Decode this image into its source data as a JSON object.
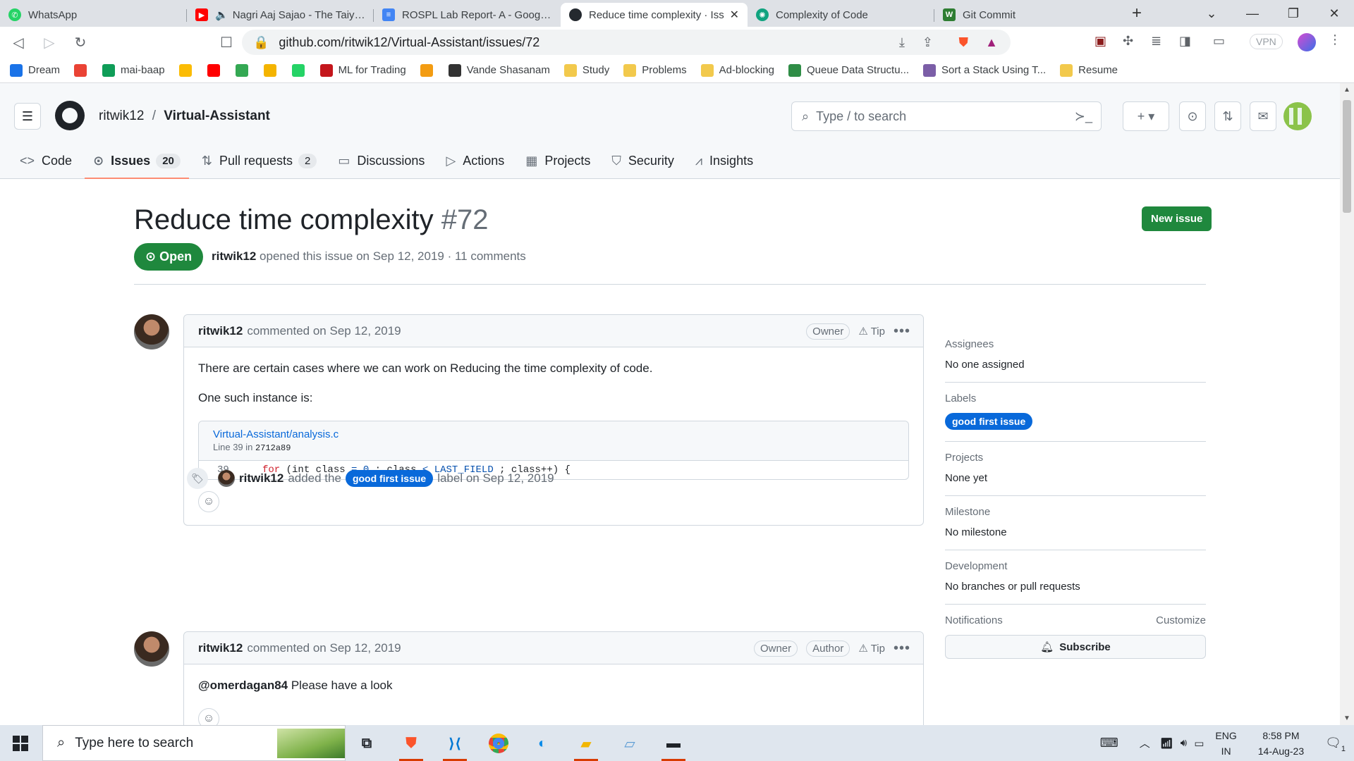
{
  "browser": {
    "tabs": [
      {
        "title": "WhatsApp",
        "color": "#25d366"
      },
      {
        "title": "Nagri Aaj Sajao - The Taiyyari",
        "color": "#ff0000"
      },
      {
        "title": "ROSPL Lab Report- A - Google D",
        "color": "#4285f4"
      },
      {
        "title": "Reduce time complexity · Iss",
        "color": "#24292f",
        "active": true
      },
      {
        "title": "Complexity of Code",
        "color": "#10a37f"
      },
      {
        "title": "Git Commit",
        "color": "#2e7d32"
      }
    ],
    "url": "github.com/ritwik12/Virtual-Assistant/issues/72",
    "vpn_label": "VPN",
    "bookmarks": [
      {
        "label": "Dream",
        "color": "#1a73e8"
      },
      {
        "label": "",
        "color": "#ea4335"
      },
      {
        "label": "mai-baap",
        "color": "#0f9d58"
      },
      {
        "label": "",
        "color": "#fbbc05"
      },
      {
        "label": "",
        "color": "#ff0000"
      },
      {
        "label": "",
        "color": "#34a853"
      },
      {
        "label": "",
        "color": "#f4b400"
      },
      {
        "label": "",
        "color": "#25d366"
      },
      {
        "label": "ML for Trading",
        "color": "#c4161c"
      },
      {
        "label": "",
        "color": "#f39c12"
      },
      {
        "label": "Vande Shasanam",
        "color": "#333333"
      },
      {
        "label": "Study",
        "color": "#f2c94c"
      },
      {
        "label": "Problems",
        "color": "#f2c94c"
      },
      {
        "label": "Ad-blocking",
        "color": "#f2c94c"
      },
      {
        "label": "Queue Data Structu...",
        "color": "#2f8d46"
      },
      {
        "label": "Sort a Stack Using T...",
        "color": "#7b5ea7"
      },
      {
        "label": "Resume",
        "color": "#f2c94c"
      }
    ]
  },
  "github": {
    "owner": "ritwik12",
    "repo": "Virtual-Assistant",
    "search_placeholder": "Type / to search",
    "nav": [
      {
        "label": "Code",
        "icon": "<>"
      },
      {
        "label": "Issues",
        "icon": "⊙",
        "count": "20",
        "selected": true
      },
      {
        "label": "Pull requests",
        "icon": "⇅",
        "count": "2"
      },
      {
        "label": "Discussions",
        "icon": "▭"
      },
      {
        "label": "Actions",
        "icon": "▷"
      },
      {
        "label": "Projects",
        "icon": "▦"
      },
      {
        "label": "Security",
        "icon": "⛉"
      },
      {
        "label": "Insights",
        "icon": "⩘"
      }
    ]
  },
  "issue": {
    "title": "Reduce time complexity",
    "number": "#72",
    "new_issue_label": "New issue",
    "state": "Open",
    "author": "ritwik12",
    "meta_text": "opened this issue on Sep 12, 2019 · 11 comments"
  },
  "comments": [
    {
      "author": "ritwik12",
      "time": "commented on Sep 12, 2019",
      "roles": [
        "Owner"
      ],
      "tip": "Tip",
      "body": [
        "There are certain cases where we can work on Reducing the time complexity of code.",
        "One such instance is:"
      ],
      "code": {
        "file": "Virtual-Assistant/analysis.c",
        "line_label": "Line 39 in",
        "commit": "2712a89",
        "line_no": "39",
        "kw": "for",
        "c1": " (int class ",
        "op1": "=",
        "c2": " ",
        "n0": "0",
        "c3": " ; class ",
        "op2": "<",
        "c4": " ",
        "const": "LAST_FIELD",
        "c5": " ; class++) {"
      }
    },
    {
      "author": "ritwik12",
      "time": "commented on Sep 12, 2019",
      "roles": [
        "Owner",
        "Author"
      ],
      "tip": "Tip",
      "mention": "@omerdagan84",
      "text": " Please have a look"
    }
  ],
  "event": {
    "actor": "ritwik12",
    "pre": "added the",
    "label": "good first issue",
    "post": "label on Sep 12, 2019"
  },
  "sidebar": {
    "assignees_h": "Assignees",
    "assignees_v": "No one assigned",
    "labels_h": "Labels",
    "label": "good first issue",
    "projects_h": "Projects",
    "projects_v": "None yet",
    "milestone_h": "Milestone",
    "milestone_v": "No milestone",
    "development_h": "Development",
    "development_v": "No branches or pull requests",
    "notifications_h": "Notifications",
    "customize": "Customize",
    "subscribe": "Subscribe"
  },
  "taskbar": {
    "search_placeholder": "Type here to search",
    "lang": "ENG",
    "region": "IN",
    "time": "8:58 PM",
    "date": "14-Aug-23",
    "notif_count": "1"
  }
}
